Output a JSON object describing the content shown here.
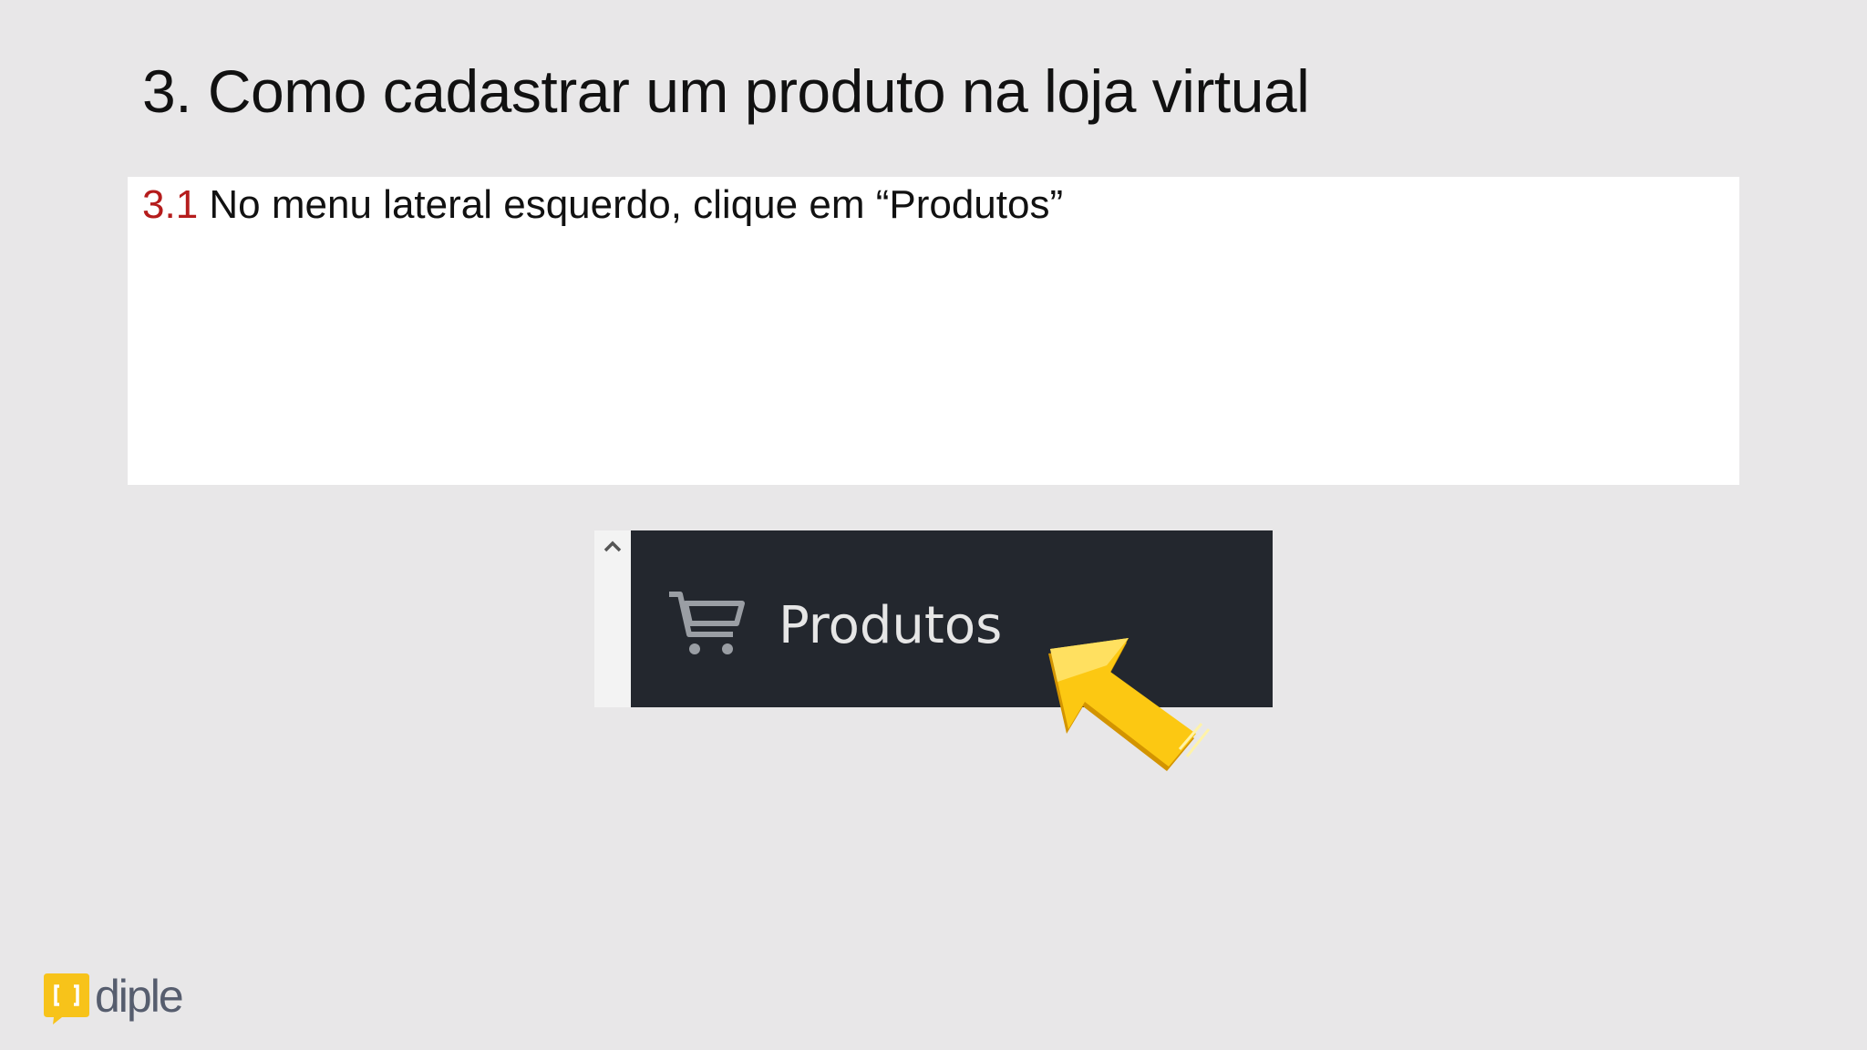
{
  "slide": {
    "title": "3. Como cadastrar um produto na loja virtual"
  },
  "step": {
    "number": "3.1",
    "text": "No menu lateral esquerdo, clique em “Produtos”"
  },
  "menu": {
    "icon": "cart-icon",
    "label": "Produtos"
  },
  "branding": {
    "name": "diple",
    "badge_color": "#f7c31a"
  }
}
